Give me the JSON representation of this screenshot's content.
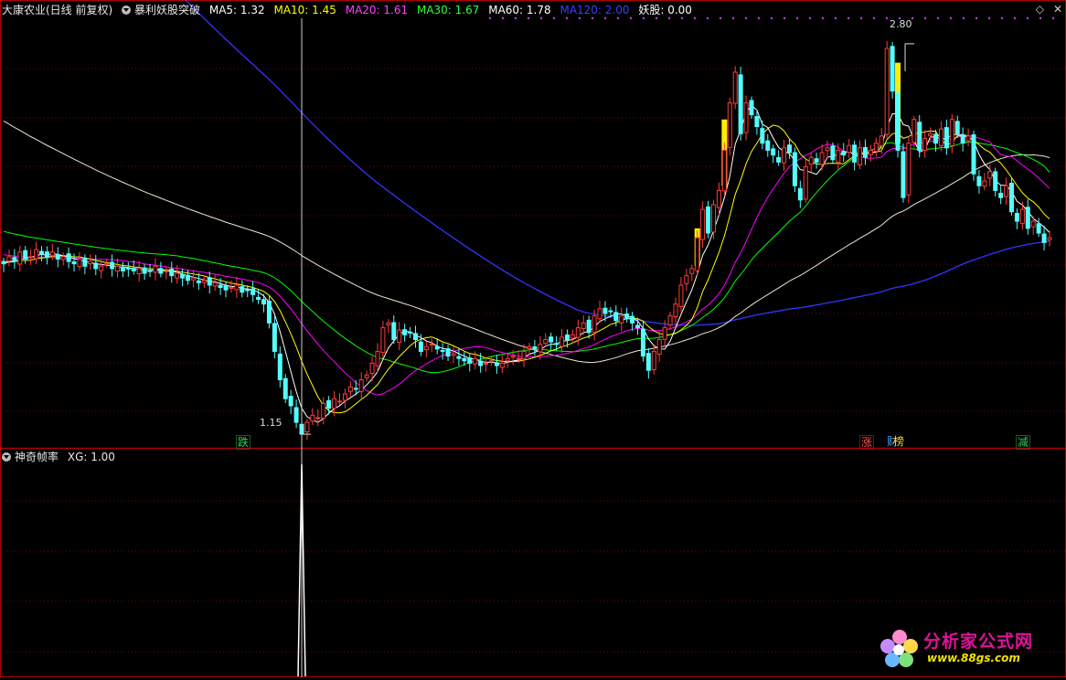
{
  "header": {
    "stock": "大康农业(日线 前复权)",
    "indicator": "暴利妖股突破",
    "ma5": "MA5: 1.32",
    "ma10": "MA10: 1.45",
    "ma20": "MA20: 1.61",
    "ma30": "MA30: 1.67",
    "ma60": "MA60: 1.78",
    "ma120": "MA120: 2.00",
    "yaogu": "妖股: 0.00"
  },
  "sub_header": {
    "indicator": "神奇帧率",
    "xg": "XG: 1.00"
  },
  "labels": {
    "high_price": "2.80",
    "low_price": "1.15"
  },
  "signals": [
    {
      "text": "跌",
      "color": "#2fd15a"
    },
    {
      "text": "涨",
      "color": "#ff4d4d"
    },
    {
      "text": "财",
      "color": "#4da6ff"
    },
    {
      "text": "榜",
      "color": "#ffd21f"
    },
    {
      "text": "减",
      "color": "#2fd15a"
    }
  ],
  "watermark": {
    "title": "分析家公式网",
    "url": "www.88gs.com"
  },
  "colors": {
    "up": "#ff3b3b",
    "down": "#54ffff",
    "ma5": "#ffffff",
    "ma10": "#ffff00",
    "ma20": "#ff00ff",
    "ma30": "#00ff00",
    "ma60": "#ffffff",
    "ma120": "#3333ff",
    "grid": "#7a0000",
    "border": "#b00000",
    "breakout": "#ffee00"
  },
  "chart_data": [
    {
      "type": "candlestick",
      "title": "大康农业(日线 前复权)",
      "ylim": [
        1.1,
        2.9
      ],
      "annotations": {
        "max": 2.8,
        "min": 1.15
      },
      "series": [
        {
          "name": "MA5",
          "last": 1.32
        },
        {
          "name": "MA10",
          "last": 1.45
        },
        {
          "name": "MA20",
          "last": 1.61
        },
        {
          "name": "MA30",
          "last": 1.67
        },
        {
          "name": "MA60",
          "last": 1.78
        },
        {
          "name": "MA120",
          "last": 2.0
        }
      ],
      "closes": [
        1.87,
        1.9,
        1.88,
        1.92,
        1.89,
        1.9,
        1.93,
        1.91,
        1.9,
        1.92,
        1.89,
        1.9,
        1.88,
        1.87,
        1.89,
        1.86,
        1.88,
        1.85,
        1.86,
        1.87,
        1.85,
        1.86,
        1.84,
        1.85,
        1.84,
        1.85,
        1.83,
        1.84,
        1.86,
        1.83,
        1.84,
        1.82,
        1.83,
        1.81,
        1.8,
        1.81,
        1.79,
        1.8,
        1.78,
        1.79,
        1.77,
        1.76,
        1.77,
        1.78,
        1.75,
        1.76,
        1.74,
        1.72,
        1.7,
        1.62,
        1.5,
        1.38,
        1.3,
        1.27,
        1.2,
        1.15,
        1.2,
        1.23,
        1.22,
        1.28,
        1.26,
        1.3,
        1.29,
        1.32,
        1.35,
        1.34,
        1.38,
        1.4,
        1.45,
        1.5,
        1.6,
        1.62,
        1.55,
        1.59,
        1.57,
        1.58,
        1.55,
        1.5,
        1.52,
        1.53,
        1.51,
        1.5,
        1.48,
        1.49,
        1.47,
        1.46,
        1.45,
        1.47,
        1.44,
        1.45,
        1.46,
        1.44,
        1.45,
        1.47,
        1.48,
        1.47,
        1.5,
        1.52,
        1.51,
        1.53,
        1.55,
        1.54,
        1.53,
        1.56,
        1.55,
        1.57,
        1.6,
        1.62,
        1.58,
        1.65,
        1.68,
        1.66,
        1.67,
        1.63,
        1.65,
        1.64,
        1.62,
        1.6,
        1.48,
        1.42,
        1.5,
        1.55,
        1.6,
        1.65,
        1.7,
        1.78,
        1.82,
        1.85,
        1.98,
        2.1,
        2.0,
        2.12,
        2.18,
        2.35,
        2.55,
        2.68,
        2.42,
        2.55,
        2.5,
        2.45,
        2.38,
        2.35,
        2.33,
        2.3,
        2.36,
        2.34,
        2.2,
        2.14,
        2.28,
        2.32,
        2.3,
        2.34,
        2.36,
        2.31,
        2.35,
        2.33,
        2.37,
        2.3,
        2.36,
        2.32,
        2.35,
        2.38,
        2.41,
        2.78,
        2.6,
        2.35,
        2.15,
        2.38,
        2.48,
        2.35,
        2.4,
        2.42,
        2.38,
        2.44,
        2.36,
        2.48,
        2.42,
        2.38,
        2.41,
        2.25,
        2.2,
        2.22,
        2.26,
        2.18,
        2.15,
        2.2,
        2.09,
        2.05,
        2.1,
        2.02,
        2.05,
        2.0,
        1.96,
        1.98
      ]
    },
    {
      "type": "line",
      "title": "神奇帧率",
      "series": [
        {
          "name": "XG",
          "last": 1.0
        }
      ],
      "signal_index": 55
    }
  ]
}
